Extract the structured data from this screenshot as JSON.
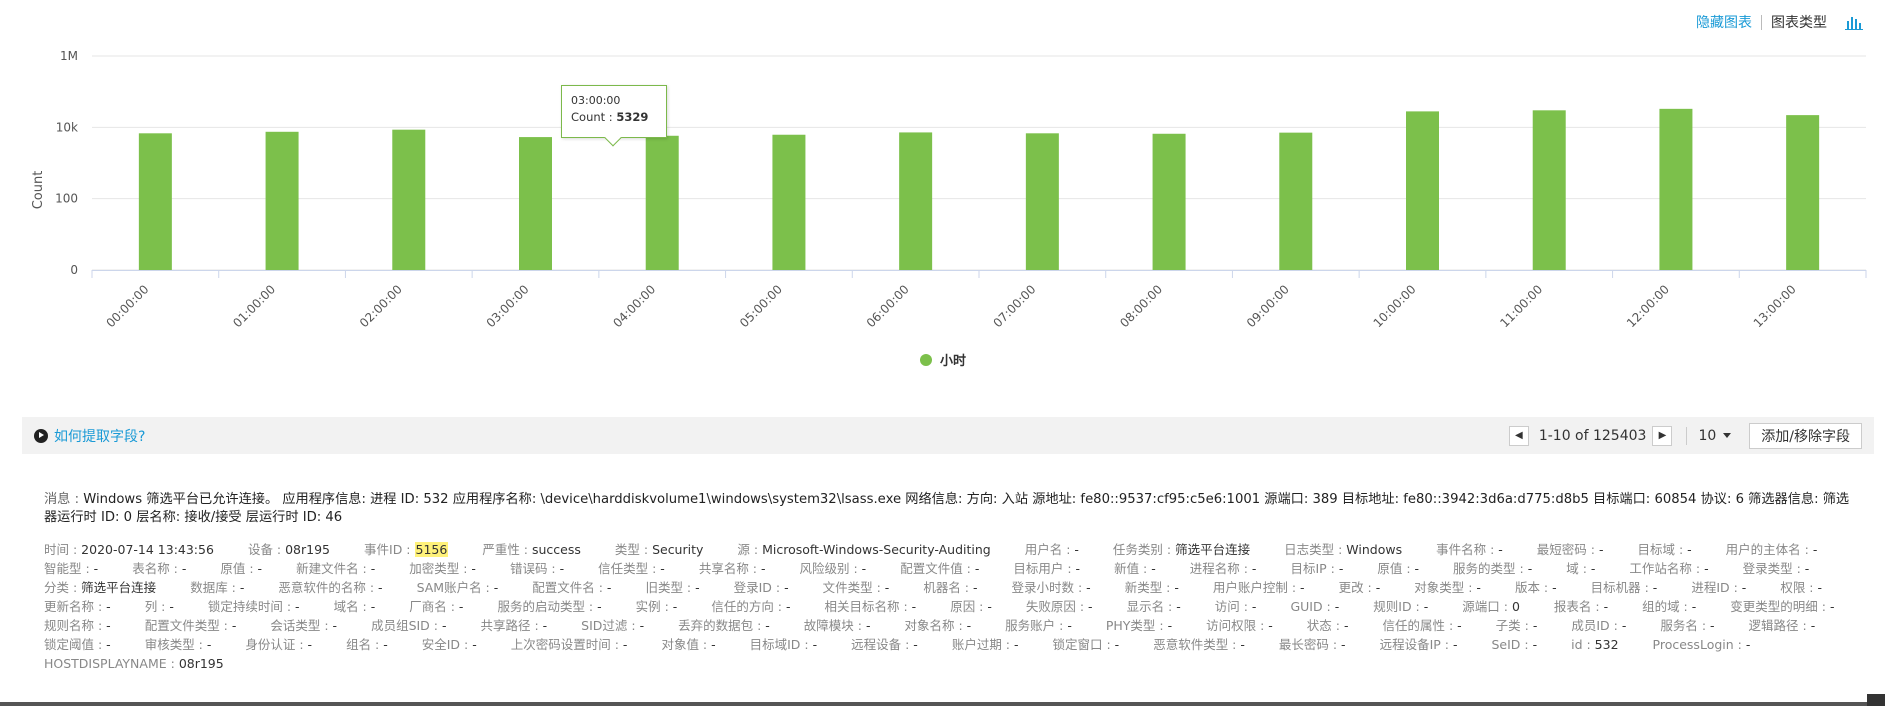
{
  "toolbar": {
    "hide_chart": "隐藏图表",
    "chart_type": "图表类型",
    "chart_type_icon": "bar-chart-icon"
  },
  "colors": {
    "bar": "#7cc04b",
    "link": "#1a9ad6",
    "highlight": "#fff27a"
  },
  "chart_data": {
    "type": "bar",
    "ylabel": "Count",
    "y_scale": "log",
    "y_ticks": [
      "1M",
      "10k",
      "100",
      "0"
    ],
    "ylim": [
      1,
      1000000
    ],
    "categories": [
      "00:00:00",
      "01:00:00",
      "02:00:00",
      "03:00:00",
      "04:00:00",
      "05:00:00",
      "06:00:00",
      "07:00:00",
      "08:00:00",
      "09:00:00",
      "10:00:00",
      "11:00:00",
      "12:00:00",
      "13:00:00"
    ],
    "series": [
      {
        "name": "小时",
        "values": [
          6800,
          7500,
          8600,
          5329,
          5800,
          6200,
          7200,
          6800,
          6600,
          7100,
          28000,
          30000,
          33000,
          22000
        ]
      }
    ],
    "legend_position": "bottom-center",
    "grid": true,
    "tooltip": {
      "time": "03:00:00",
      "label": "Count",
      "value": "5329"
    }
  },
  "fieldbar": {
    "howto": "如何提取字段?",
    "range": "1-10 of 125403",
    "per_page": "10",
    "add_remove": "添加/移除字段"
  },
  "message": {
    "key": "消息 : ",
    "text": "Windows 筛选平台已允许连接。 应用程序信息: 进程 ID: 532 应用程序名称: \\device\\harddiskvolume1\\windows\\system32\\lsass.exe 网络信息: 方向: 入站 源地址: fe80::9537:cf95:c5e6:1001 源端口: 389 目标地址: fe80::3942:3d6a:d775:d8b5 目标端口: 60854 协议: 6 筛选器信息: 筛选器运行时 ID: 0 层名称: 接收/接受 层运行时 ID: 46"
  },
  "fields": [
    {
      "k": "时间 : ",
      "v": "2020-07-14 13:43:56"
    },
    {
      "k": "设备 : ",
      "v": "08r195"
    },
    {
      "k": "事件ID : ",
      "v": "5156",
      "hl": true
    },
    {
      "k": "严重性 : ",
      "v": "success"
    },
    {
      "k": "类型 : ",
      "v": "Security"
    },
    {
      "k": "源 : ",
      "v": "Microsoft-Windows-Security-Auditing"
    },
    {
      "k": "用户名 : ",
      "v": "-"
    },
    {
      "k": "任务类别 : ",
      "v": "筛选平台连接"
    },
    {
      "k": "日志类型 : ",
      "v": "Windows"
    },
    {
      "k": "事件名称 : ",
      "v": "-"
    },
    {
      "k": "最短密码 : ",
      "v": "-"
    },
    {
      "k": "目标域 : ",
      "v": "-"
    },
    {
      "k": "用户的主体名 : ",
      "v": "-"
    },
    {
      "k": "智能型 : ",
      "v": "-"
    },
    {
      "k": "表名称 : ",
      "v": "-"
    },
    {
      "k": "原值 : ",
      "v": "-"
    },
    {
      "k": "新建文件名 : ",
      "v": "-"
    },
    {
      "k": "加密类型 : ",
      "v": "-"
    },
    {
      "k": "错误码 : ",
      "v": "-"
    },
    {
      "k": "信任类型 : ",
      "v": "-"
    },
    {
      "k": "共享名称 : ",
      "v": "-"
    },
    {
      "k": "风险级别 : ",
      "v": "-"
    },
    {
      "k": "配置文件值 : ",
      "v": "-"
    },
    {
      "k": "目标用户 : ",
      "v": "-"
    },
    {
      "k": "新值 : ",
      "v": "-"
    },
    {
      "k": "进程名称 : ",
      "v": "-"
    },
    {
      "k": "目标IP : ",
      "v": "-"
    },
    {
      "k": "原值 : ",
      "v": "-"
    },
    {
      "k": "服务的类型 : ",
      "v": "-"
    },
    {
      "k": "域 : ",
      "v": "-"
    },
    {
      "k": "工作站名称 : ",
      "v": "-"
    },
    {
      "k": "登录类型 : ",
      "v": "-"
    },
    {
      "k": "分类 : ",
      "v": "筛选平台连接"
    },
    {
      "k": "数据库 : ",
      "v": "-"
    },
    {
      "k": "恶意软件的名称 : ",
      "v": "-"
    },
    {
      "k": "SAM账户名 : ",
      "v": "-"
    },
    {
      "k": "配置文件名 : ",
      "v": "-"
    },
    {
      "k": "旧类型 : ",
      "v": "-"
    },
    {
      "k": "登录ID : ",
      "v": "-"
    },
    {
      "k": "文件类型 : ",
      "v": "-"
    },
    {
      "k": "机器名 : ",
      "v": "-"
    },
    {
      "k": "登录小时数 : ",
      "v": "-"
    },
    {
      "k": "新类型 : ",
      "v": "-"
    },
    {
      "k": "用户账户控制 : ",
      "v": "-"
    },
    {
      "k": "更改 : ",
      "v": "-"
    },
    {
      "k": "对象类型 : ",
      "v": "-"
    },
    {
      "k": "版本 : ",
      "v": "-"
    },
    {
      "k": "目标机器 : ",
      "v": "-"
    },
    {
      "k": "进程ID : ",
      "v": "-"
    },
    {
      "k": "权限 : ",
      "v": "-"
    },
    {
      "k": "更新名称 : ",
      "v": "-"
    },
    {
      "k": "列 : ",
      "v": "-"
    },
    {
      "k": "锁定持续时间 : ",
      "v": "-"
    },
    {
      "k": "域名 : ",
      "v": "-"
    },
    {
      "k": "厂商名 : ",
      "v": "-"
    },
    {
      "k": "服务的启动类型 : ",
      "v": "-"
    },
    {
      "k": "实例 : ",
      "v": "-"
    },
    {
      "k": "信任的方向 : ",
      "v": "-"
    },
    {
      "k": "相关目标名称 : ",
      "v": "-"
    },
    {
      "k": "原因 : ",
      "v": "-"
    },
    {
      "k": "失败原因 : ",
      "v": "-"
    },
    {
      "k": "显示名 : ",
      "v": "-"
    },
    {
      "k": "访问 : ",
      "v": "-"
    },
    {
      "k": "GUID : ",
      "v": "-"
    },
    {
      "k": "规则ID : ",
      "v": "-"
    },
    {
      "k": "源端口 : ",
      "v": "0"
    },
    {
      "k": "报表名 : ",
      "v": "-"
    },
    {
      "k": "组的域 : ",
      "v": "-"
    },
    {
      "k": "变更类型的明细 : ",
      "v": "-"
    },
    {
      "k": "规则名称 : ",
      "v": "-"
    },
    {
      "k": "配置文件类型 : ",
      "v": "-"
    },
    {
      "k": "会话类型 : ",
      "v": "-"
    },
    {
      "k": "成员组SID : ",
      "v": "-"
    },
    {
      "k": "共享路径 : ",
      "v": "-"
    },
    {
      "k": "SID过滤 : ",
      "v": "-"
    },
    {
      "k": "丢弃的数据包 : ",
      "v": "-"
    },
    {
      "k": "故障模块 : ",
      "v": "-"
    },
    {
      "k": "对象名称 : ",
      "v": "-"
    },
    {
      "k": "服务账户 : ",
      "v": "-"
    },
    {
      "k": "PHY类型 : ",
      "v": "-"
    },
    {
      "k": "访问权限 : ",
      "v": "-"
    },
    {
      "k": "状态 : ",
      "v": "-"
    },
    {
      "k": "信任的属性 : ",
      "v": "-"
    },
    {
      "k": "子类 : ",
      "v": "-"
    },
    {
      "k": "成员ID : ",
      "v": "-"
    },
    {
      "k": "服务名 : ",
      "v": "-"
    },
    {
      "k": "逻辑路径 : ",
      "v": "-"
    },
    {
      "k": "锁定阈值 : ",
      "v": "-"
    },
    {
      "k": "审核类型 : ",
      "v": "-"
    },
    {
      "k": "身份认证 : ",
      "v": "-"
    },
    {
      "k": "组名 : ",
      "v": "-"
    },
    {
      "k": "安全ID : ",
      "v": "-"
    },
    {
      "k": "上次密码设置时间 : ",
      "v": "-"
    },
    {
      "k": "对象值 : ",
      "v": "-"
    },
    {
      "k": "目标域ID : ",
      "v": "-"
    },
    {
      "k": "远程设备 : ",
      "v": "-"
    },
    {
      "k": "账户过期 : ",
      "v": "-"
    },
    {
      "k": "锁定窗口 : ",
      "v": "-"
    },
    {
      "k": "恶意软件类型 : ",
      "v": "-"
    },
    {
      "k": "最长密码 : ",
      "v": "-"
    },
    {
      "k": "远程设备IP : ",
      "v": "-"
    },
    {
      "k": "SeID : ",
      "v": "-"
    },
    {
      "k": "id : ",
      "v": "532"
    },
    {
      "k": "ProcessLogin : ",
      "v": "-"
    },
    {
      "k": "HOSTDISPLAYNAME : ",
      "v": "08r195"
    }
  ]
}
